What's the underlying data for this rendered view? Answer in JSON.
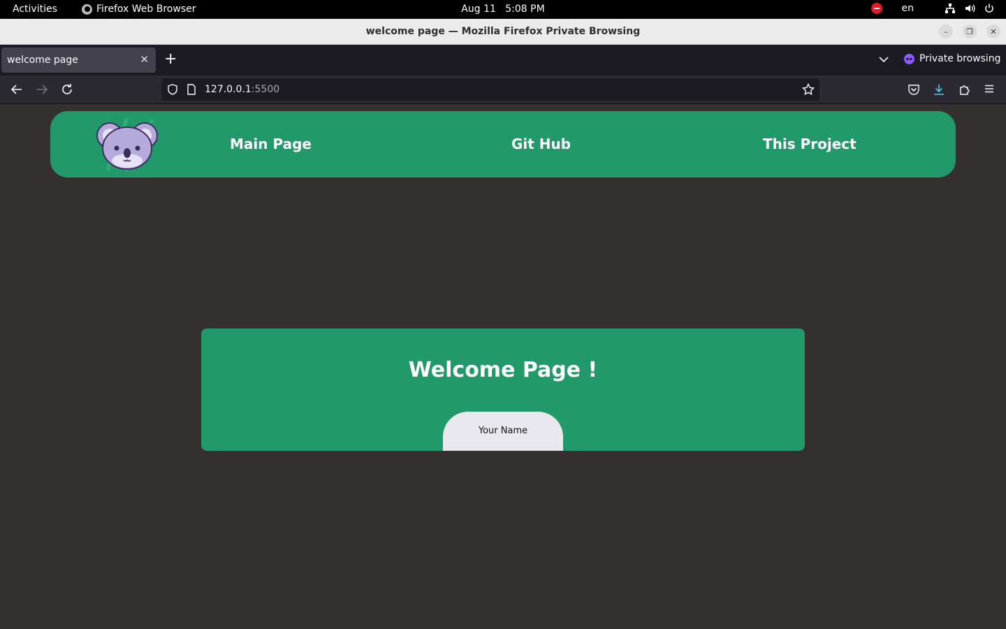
{
  "system": {
    "activities": "Activities",
    "app_name": "Firefox Web Browser",
    "date": "Aug 11",
    "time": "5:08 PM",
    "language": "en"
  },
  "window": {
    "title": "welcome page — Mozilla Firefox Private Browsing"
  },
  "tabs": [
    {
      "title": "welcome page",
      "active": true
    }
  ],
  "browser": {
    "private_label": "Private browsing",
    "url_host": "127.0.0.1",
    "url_port": ":5500"
  },
  "site": {
    "nav": {
      "links": [
        "Main Page",
        "Git Hub",
        "This Project"
      ]
    },
    "welcome": {
      "title": "Welcome Page !",
      "name_label": "Your Name"
    }
  },
  "colors": {
    "page_background": "#363131",
    "brand_green": "#22996a",
    "name_pill": "#e9e8ee",
    "koala": "#b6a9dc"
  },
  "icons": {
    "logo": "koala-icon"
  }
}
